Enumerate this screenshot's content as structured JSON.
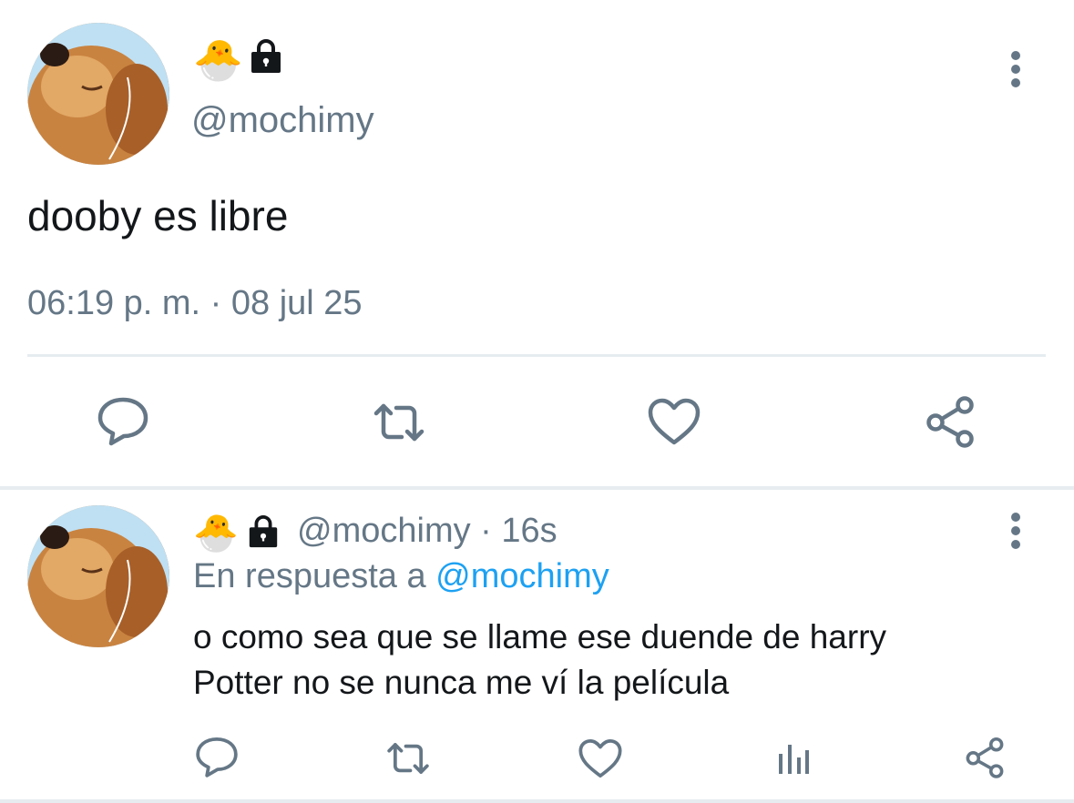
{
  "colors": {
    "text": "#14171a",
    "secondary": "#657786",
    "link": "#1da1f2",
    "divider": "#e6ecf0",
    "icon": "#657786"
  },
  "main_tweet": {
    "badge_emoji": "🐣",
    "lock_icon": "lock-icon",
    "handle": "@mochimy",
    "text": "dooby es libre",
    "timestamp": "06:19 p. m. · 08 jul 25",
    "actions": [
      "reply-icon",
      "retweet-icon",
      "like-icon",
      "share-icon"
    ],
    "menu_icon": "more-vertical-icon"
  },
  "reply_tweet": {
    "badge_emoji": "🐣",
    "handle": "@mochimy",
    "separator": " · ",
    "time_ago": "16s",
    "reply_prefix": "En respuesta a ",
    "reply_to_handle": "@mochimy",
    "text_line1": "o como sea que se llame ese duende de harry",
    "text_line2": "Potter no se nunca me ví la película",
    "actions": [
      "reply-icon",
      "retweet-icon",
      "like-icon",
      "analytics-icon",
      "share-icon"
    ],
    "menu_icon": "more-vertical-icon"
  }
}
